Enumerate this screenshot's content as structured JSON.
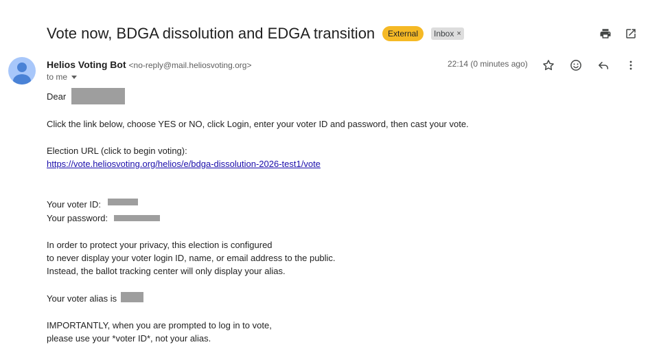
{
  "email": {
    "subject": "Vote now, BDGA dissolution and EDGA transition",
    "labels": {
      "external": "External",
      "inbox": "Inbox",
      "inbox_remove": "×"
    },
    "sender": {
      "name": "Helios Voting Bot",
      "email": "<no-reply@mail.heliosvoting.org>"
    },
    "recipient_label": "to me",
    "timestamp": "22:14 (0 minutes ago)",
    "body": {
      "greeting": "Dear",
      "instructions": "Click the link below, choose YES or NO, click Login, enter your voter ID and password, then cast your vote.",
      "election_url_label": "Election URL (click to begin voting):",
      "election_url": "https://vote.heliosvoting.org/helios/e/bdga-dissolution-2026-test1/vote",
      "voter_id_label": "Your voter ID:",
      "password_label": "Your password:",
      "privacy_1": "In order to protect your privacy, this election is configured",
      "privacy_2": "to never display your voter login ID, name, or email address to the public.",
      "privacy_3": "Instead, the ballot tracking center will only display your alias.",
      "alias_label": "Your voter alias is",
      "important_1": "IMPORTANTLY, when you are prompted to log in to vote,",
      "important_2": "please use your *voter ID*, not your alias."
    }
  },
  "icons": {
    "print": "print-icon",
    "open_new_window": "open-in-new-icon",
    "avatar": "person-avatar-icon",
    "star": "star-icon",
    "emoji": "emoji-icon",
    "reply": "reply-icon",
    "more": "more-vert-icon",
    "caret": "chevron-down-icon"
  },
  "colors": {
    "external_badge": "#f5b925",
    "inbox_badge": "#dddddd",
    "link": "#1a0dab",
    "avatar_bg": "#a8c7fa",
    "avatar_fg": "#4a82d6",
    "redaction": "#9e9e9e"
  }
}
